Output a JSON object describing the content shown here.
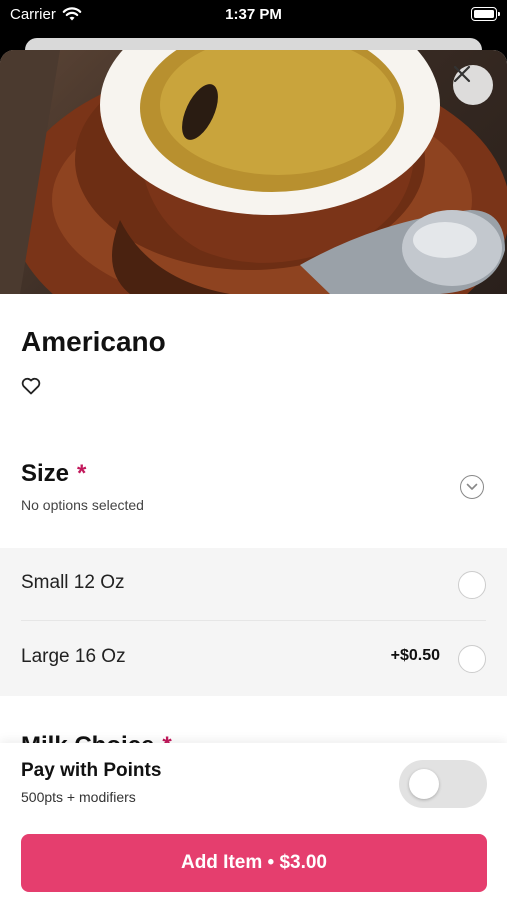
{
  "status_bar": {
    "carrier": "Carrier",
    "time": "1:37 PM"
  },
  "product": {
    "title": "Americano",
    "image": "espresso-cup-photo"
  },
  "icons": {
    "close": "close-icon",
    "favorite": "heart-outline-icon",
    "expand": "chevron-down-icon",
    "wifi": "wifi-icon",
    "battery": "battery-icon"
  },
  "size_section": {
    "title": "Size",
    "required_mark": "*",
    "subtitle": "No options selected",
    "options": [
      {
        "label": "Small 12 Oz",
        "price": ""
      },
      {
        "label": "Large 16 Oz",
        "price": "+$0.50"
      }
    ]
  },
  "milk_section": {
    "title": "Milk Choice",
    "required_mark": "*"
  },
  "footer": {
    "points_title": "Pay with Points",
    "points_subtitle": "500pts + modifiers",
    "pay_with_points_enabled": false,
    "add_button_label": "Add Item • $3.00"
  },
  "colors": {
    "accent": "#e53e6e",
    "required": "#c2185b"
  }
}
